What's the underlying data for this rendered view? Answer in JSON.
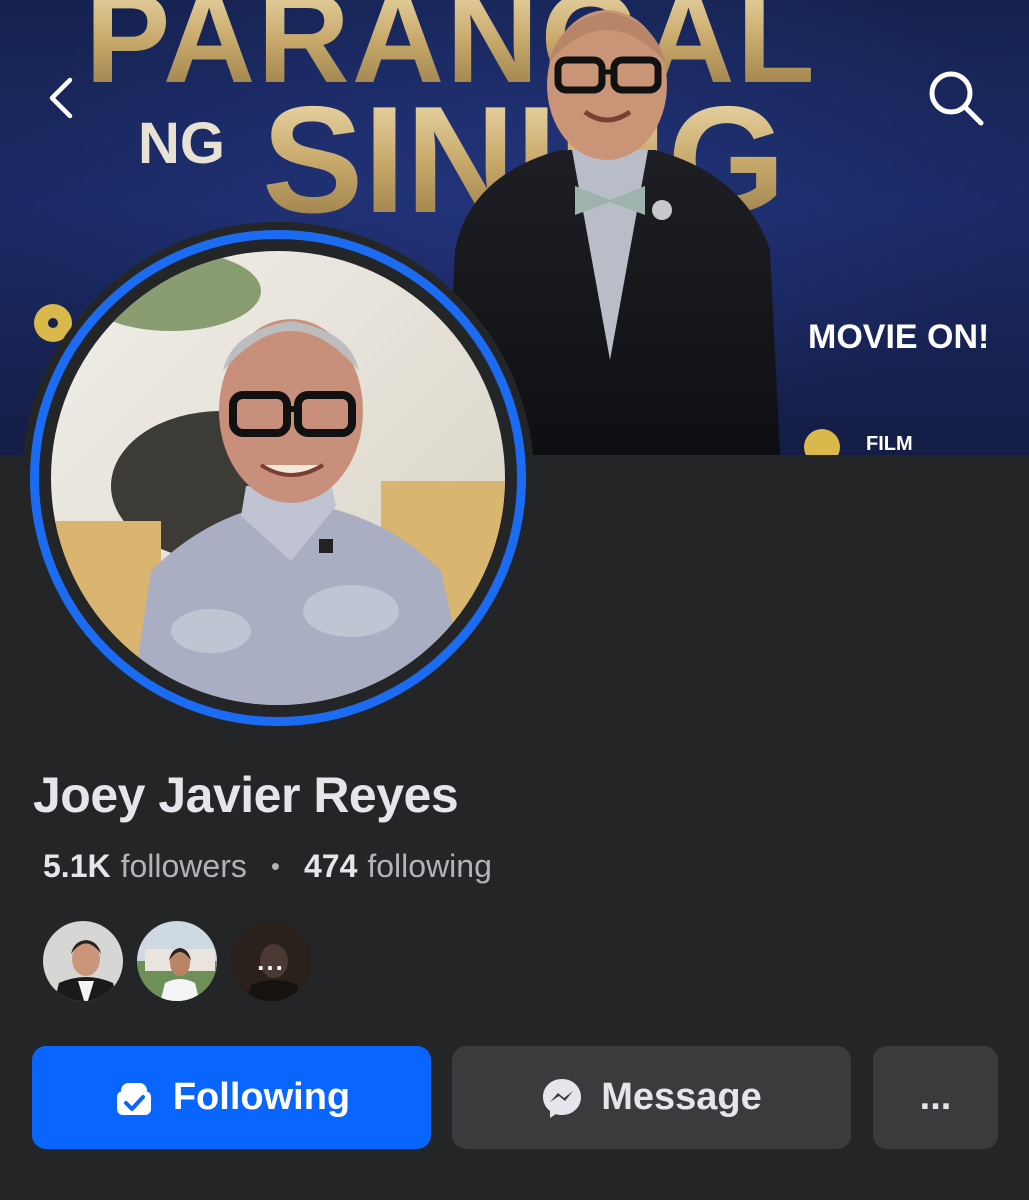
{
  "cover": {
    "sign_line1": "PARANGAL",
    "sign_line2_small": "NG",
    "sign_line2_big": "SINING",
    "movie_on": "MOVIE ON!",
    "film_label": "FILM"
  },
  "nav": {
    "back_icon": "chevron-left-icon",
    "search_icon": "search-icon"
  },
  "profile": {
    "name": "Joey Javier Reyes",
    "followers_count": "5.1K",
    "followers_label": "followers",
    "separator": "•",
    "following_count": "474",
    "following_label": "following"
  },
  "mutuals": {
    "more_label": "..."
  },
  "actions": {
    "following_label": "Following",
    "message_label": "Message",
    "more_label": "..."
  },
  "colors": {
    "accent": "#0866ff",
    "ring": "#1b6cf2",
    "background": "#242526",
    "secondary_button": "#3a3b3c"
  }
}
